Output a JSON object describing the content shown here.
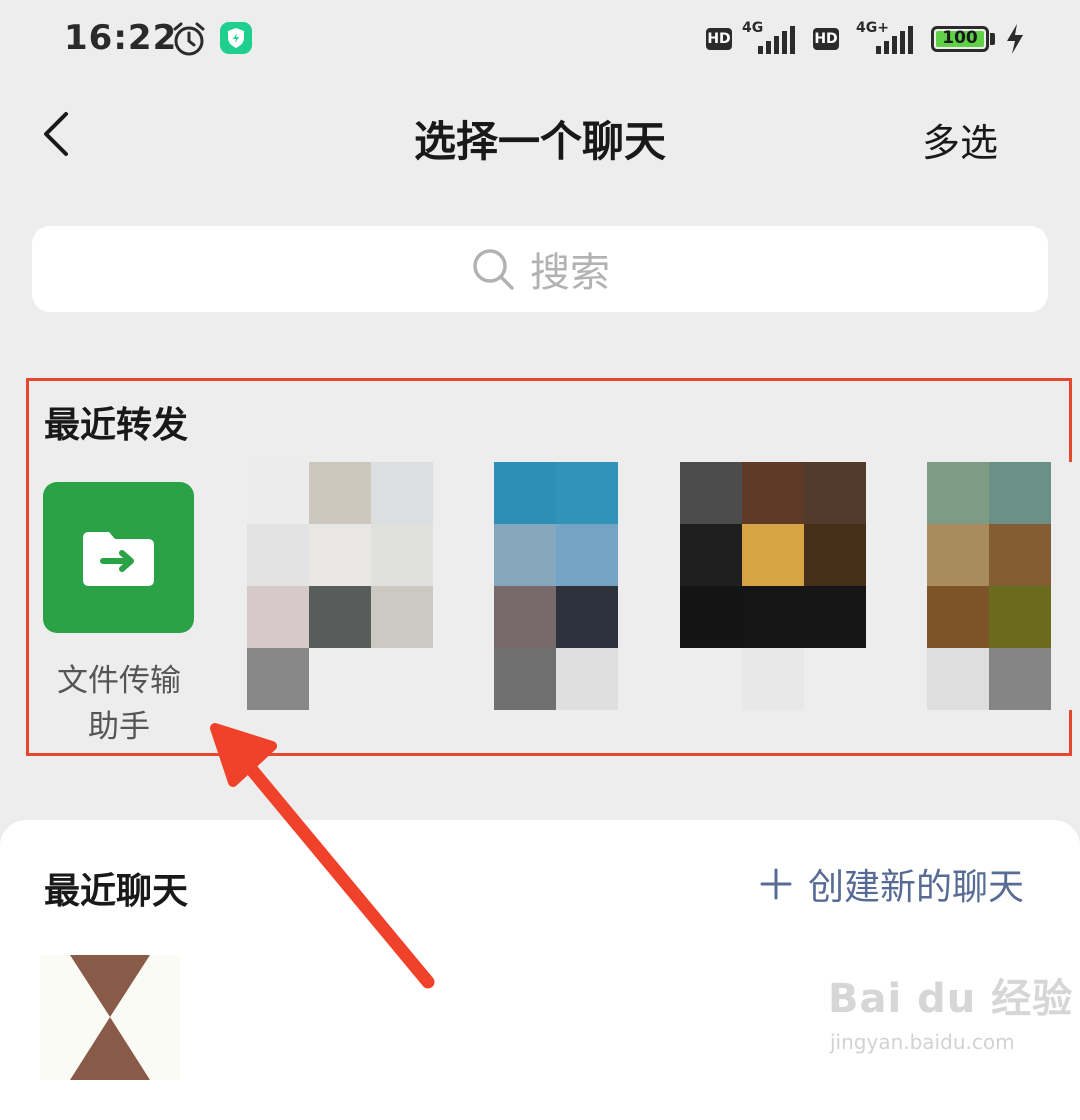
{
  "status_bar": {
    "time": "16:22",
    "hd_1": "HD",
    "net_1": "4G",
    "hd_2": "HD",
    "net_2": "4G+",
    "battery": "100"
  },
  "header": {
    "title": "选择一个聊天",
    "multi_select": "多选"
  },
  "search": {
    "placeholder": "搜索"
  },
  "recent_forward": {
    "title": "最近转发",
    "items": [
      {
        "label_line1": "文件传输",
        "label_line2": "助手",
        "icon": "folder-arrow-icon"
      }
    ]
  },
  "recent_chats": {
    "title": "最近聊天",
    "new_chat": "创建新的聊天"
  },
  "watermark": {
    "brand": "Bai du 经验",
    "url": "jingyan.baidu.com"
  },
  "colors": {
    "accent_green": "#2ba245",
    "link_blue": "#576b95",
    "highlight_red": "#e8472f"
  }
}
